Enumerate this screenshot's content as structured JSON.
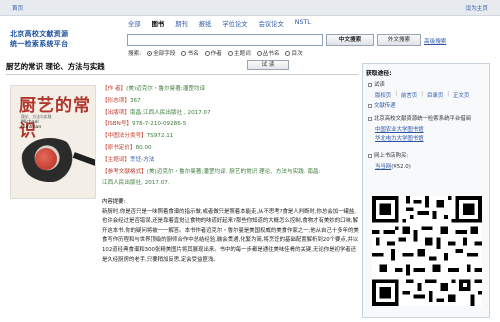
{
  "topbar": {
    "home": "首页",
    "set_home": "设为主页"
  },
  "logo": {
    "line1": "北京高校文献资源",
    "line2": "统一检索系统平台"
  },
  "tabs": [
    "全部",
    "图书",
    "期刊",
    "报纸",
    "学位论文",
    "会议论文",
    "NSTL"
  ],
  "active_tab": "图书",
  "search": {
    "value": "",
    "cn_button": "中文搜索",
    "en_button": "外文搜索",
    "advanced": "高级搜索"
  },
  "radios": {
    "lead": "搜索:",
    "options": [
      "全部字段",
      "书名",
      "作者",
      "主题词",
      "丛书名",
      "目次"
    ],
    "selected": "全部字段"
  },
  "try_button": "试 读",
  "book": {
    "title": "厨艺的常识 理论、方法与实践",
    "cover_title": "厨艺的常识",
    "cover_sub": "理论、方法与实践",
    "cover_author": "Michael\nRuhlman",
    "meta": [
      {
        "label": "【作  者】",
        "value": "(美)迈克尔・鲁尔曼著;潘罡均译",
        "type": "val"
      },
      {
        "label": "【形态项】",
        "value": "367",
        "type": "val"
      },
      {
        "label": "【出版项】",
        "value": "南昌:江西人民出版社 , 2017.07",
        "type": "val"
      },
      {
        "label": "【ISBN号】",
        "value": "978-7-210-09286-5",
        "type": "val"
      },
      {
        "label": "【中图法分类号】",
        "value": "TS972.11",
        "type": "val"
      },
      {
        "label": "【原书定价】",
        "value": "80.00",
        "type": "val"
      },
      {
        "label": "【主题词】",
        "value": "烹饪-方法",
        "type": "lnk"
      },
      {
        "label": "【参考文献格式】",
        "value": "(美)迈克尔・鲁尔曼著;潘罡均译. 厨艺的常识 理论、方法与实践. 南昌:",
        "type": "val"
      },
      {
        "label": "",
        "value": "江西人民出版社, 2017.07.",
        "type": "val"
      }
    ],
    "summary_head": "内容提要:",
    "summary": "新厨时,你是否只是一味照着食谱的指示做,或者做只是照着本能走,从不思考?食是人判断时,你总会加一罐盐,也许会经过是否错误,还是靠着直觉让食物的味道好起来?那些你知道的大概怎么控制,食物才有美妙的口味,解开这本书,你的疑问将被一一解答。本书作者迈克尔・鲁尔曼是美国权威的美食作家之一,他从自己十多年的美食写作历程和与世界顶级的厨师合作中总结经验,融会贯通,化繁为简,将烹饪的基础配置解析到20个要点,并以102道经典食谱和300张精美图片将其展现出来。书中的每一步都是通往美味佳肴的关键,无论你是初学者还是久经厨房的老手,只要稍加反思,定会受益匪浅。"
  },
  "right_panel": {
    "title": "获取途径:",
    "trial": "试读",
    "trial_links": [
      "版权页",
      "前言页",
      "目录页",
      "正文页"
    ],
    "item2": "文献传递",
    "item3": "北京高校文献资源统一检索系统平台借阅",
    "libs": [
      "中国农业大学图书馆",
      "华北电力大学图书馆"
    ],
    "item4": "网上书店购买:",
    "store": "当当网",
    "store_price": "(¥52.0)"
  }
}
